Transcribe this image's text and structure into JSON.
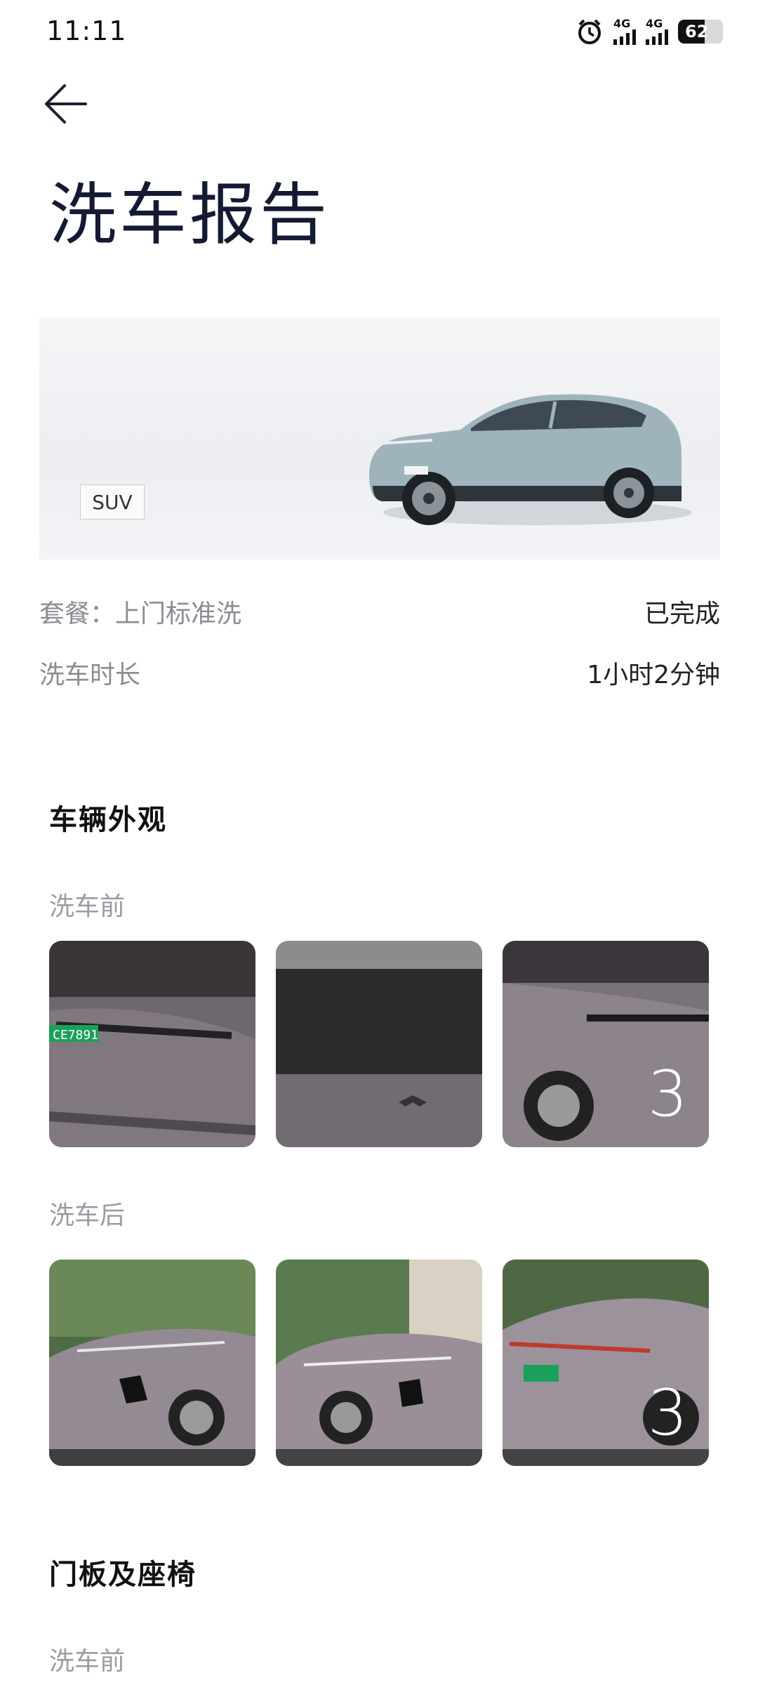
{
  "status_bar": {
    "time": "11:11",
    "battery": "62",
    "network_1": "4G",
    "network_2": "4G"
  },
  "header": {
    "title": "洗车报告"
  },
  "vehicle": {
    "tag": "SUV"
  },
  "info": {
    "package_label": "套餐：上门标准洗",
    "package_status": "已完成",
    "duration_label": "洗车时长",
    "duration_value": "1小时2分钟"
  },
  "sections": [
    {
      "title": "车辆外观",
      "before_label": "洗车前",
      "before_count": "3",
      "after_label": "洗车后",
      "after_count": "3"
    },
    {
      "title": "门板及座椅",
      "before_label": "洗车前"
    }
  ],
  "plate_text": "CE7891",
  "icons": [
    "back-arrow-icon",
    "alarm-icon",
    "signal-icon",
    "battery-icon"
  ]
}
